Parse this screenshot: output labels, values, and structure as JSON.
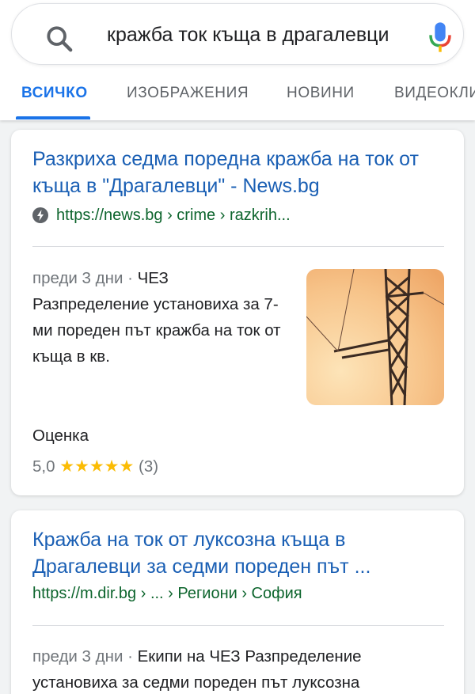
{
  "search": {
    "query": "кражба ток къща в драгалевци"
  },
  "tabs": [
    {
      "label": "ВСИЧКО"
    },
    {
      "label": "ИЗОБРАЖЕНИЯ"
    },
    {
      "label": "НОВИНИ"
    },
    {
      "label": "ВИДЕОКЛИПОВЕ"
    }
  ],
  "results": [
    {
      "title": "Разкриха седма поредна кражба на ток от къща в \"Драгалевци\" - News.bg",
      "url": "https://news.bg › crime › razkrih...",
      "date": "преди 3 дни",
      "snippet": "ЧЕЗ Разпределение установиха за 7-ми пореден път кражба на ток от къща в кв.",
      "rating_label": "Оценка",
      "rating_value": "5,0",
      "rating_stars": "★★★★★",
      "rating_count": "(3)"
    },
    {
      "title": "Кражба на ток от луксозна къща в Драгалевци за седми пореден път ...",
      "url": "https://m.dir.bg › ... › Региони › София",
      "date": "преди 3 дни",
      "snippet": "Екипи на ЧЕЗ Разпределение установиха за седми пореден път луксозна"
    }
  ],
  "colors": {
    "accent": "#1a73e8",
    "link": "#1a5fb4",
    "url": "#0d652d",
    "star": "#fbbc04"
  },
  "icons": {
    "search": "search-icon",
    "mic": "mic-icon",
    "amp": "amp-lightning-icon"
  }
}
